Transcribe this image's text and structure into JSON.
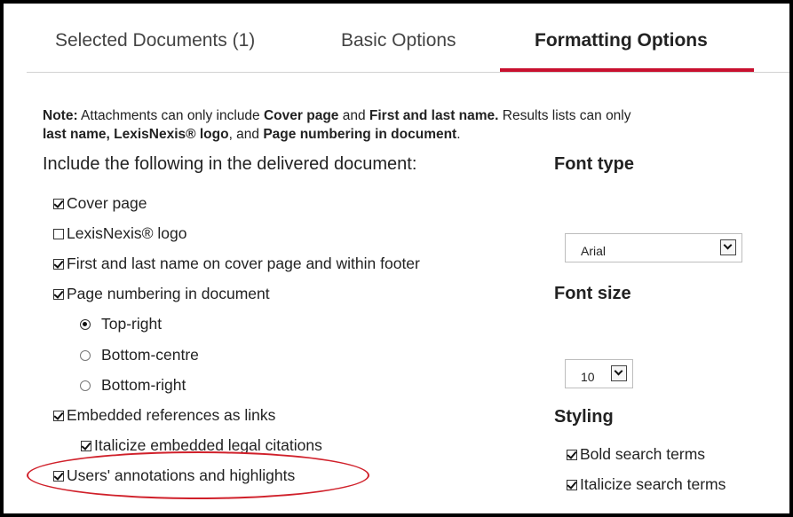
{
  "tabs": [
    {
      "label": "Selected Documents (1)",
      "active": false
    },
    {
      "label": "Basic Options",
      "active": false
    },
    {
      "label": "Formatting Options",
      "active": true
    }
  ],
  "note": {
    "prefix": "Note:",
    "t1": " Attachments can only include ",
    "b1": "Cover page",
    "t2": " and ",
    "b2": "First and last name.",
    "t3": " Results lists can only",
    "line2_b1": "last name, LexisNexis® logo",
    "line2_t1": ", and ",
    "line2_b2": "Page numbering in document",
    "line2_t2": "."
  },
  "include": {
    "heading": "Include the following in the delivered document:",
    "options": {
      "cover_page": {
        "label": "Cover page",
        "checked": true
      },
      "logo": {
        "label": "LexisNexis® logo",
        "checked": false
      },
      "first_last_name": {
        "label": "First and last name on cover page and within footer",
        "checked": true
      },
      "page_numbering": {
        "label": "Page numbering in document",
        "checked": true
      },
      "top_right": {
        "label": "Top-right",
        "selected": true
      },
      "bottom_centre": {
        "label": "Bottom-centre",
        "selected": false
      },
      "bottom_right": {
        "label": "Bottom-right",
        "selected": false
      },
      "embedded_links": {
        "label": "Embedded references as links",
        "checked": true
      },
      "italicize_citations": {
        "label": "Italicize embedded legal citations",
        "checked": true
      },
      "annotations": {
        "label": "Users' annotations and highlights",
        "checked": true
      }
    }
  },
  "font_type": {
    "heading": "Font type",
    "value": "Arial"
  },
  "font_size": {
    "heading": "Font size",
    "value": "10"
  },
  "styling": {
    "heading": "Styling",
    "bold_terms": {
      "label": "Bold search terms",
      "checked": true
    },
    "italic_terms": {
      "label": "Italicize search terms",
      "checked": true
    }
  },
  "colors": {
    "accent": "#c8102e",
    "annotation": "#d0202a"
  }
}
